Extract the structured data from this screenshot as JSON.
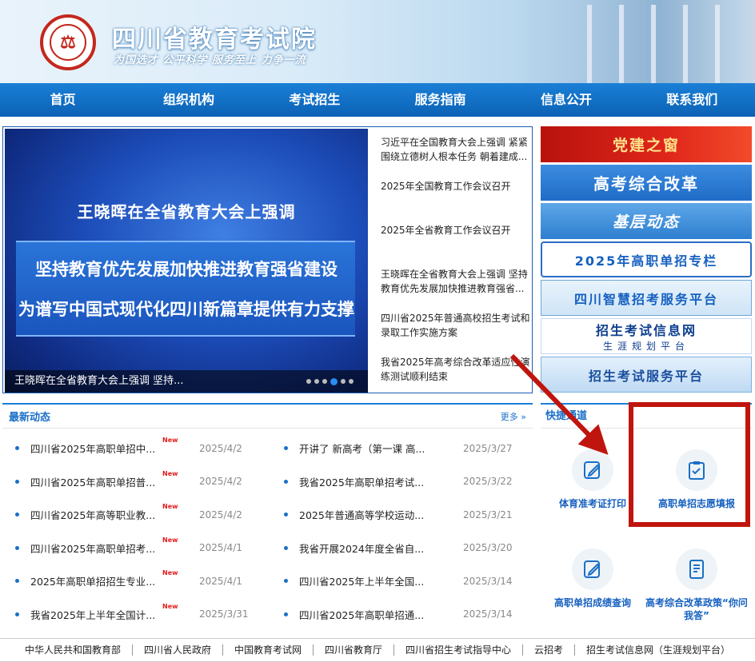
{
  "header": {
    "logo_text": "四川省教育考试院",
    "title": "四川省教育考试院",
    "motto": "为国选才  公平科学  服务至上  力争一流"
  },
  "nav": [
    {
      "label": "首页"
    },
    {
      "label": "组织机构"
    },
    {
      "label": "考试招生"
    },
    {
      "label": "服务指南"
    },
    {
      "label": "信息公开"
    },
    {
      "label": "联系我们"
    }
  ],
  "banner": {
    "line1": "王晓晖在全省教育大会上强调",
    "line2": "坚持教育优先发展加快推进教育强省建设",
    "line3": "为谱写中国式现代化四川新篇章提供有力支撑",
    "caption": "王晓晖在全省教育大会上强调 坚持...",
    "active_dot": 3
  },
  "top_news": [
    "习近平在全国教育大会上强调 紧紧围绕立德树人根本任务 朝着建成...",
    "2025年全国教育工作会议召开",
    "2025年全省教育工作会议召开",
    "王晓晖在全省教育大会上强调 坚持教育优先发展加快推进教育强省...",
    "四川省2025年普通高校招生考试和录取工作实施方案",
    "我省2025年高考综合改革适应性演练测试顺利结束"
  ],
  "side_buttons": {
    "party": "党建之窗",
    "reform": "高考综合改革",
    "grassroots": "基层动态",
    "gaozhi": "2025年高职单招专栏",
    "smart": "四川智慧招考服务平台",
    "netinfo": "招生考试信息网",
    "netinfo_sub": "生涯规划平台",
    "service": "招生考试服务平台"
  },
  "latest": {
    "title": "最新动态",
    "more": "更多 »",
    "new_label": "New",
    "left": [
      {
        "text": "四川省2025年高职单招中...",
        "date": "2025/4/2",
        "new": true
      },
      {
        "text": "四川省2025年高职单招普...",
        "date": "2025/4/2",
        "new": true
      },
      {
        "text": "四川省2025年高等职业教...",
        "date": "2025/4/2",
        "new": true
      },
      {
        "text": "四川省2025年高职单招考...",
        "date": "2025/4/1",
        "new": true
      },
      {
        "text": "2025年高职单招招生专业...",
        "date": "2025/4/1",
        "new": true
      },
      {
        "text": "我省2025年上半年全国计...",
        "date": "2025/3/31",
        "new": true
      }
    ],
    "right": [
      {
        "text": "开讲了 新高考（第一课 高...",
        "date": "2025/3/27"
      },
      {
        "text": "我省2025年高职单招考试...",
        "date": "2025/3/22"
      },
      {
        "text": "2025年普通高等学校运动...",
        "date": "2025/3/21"
      },
      {
        "text": "我省开展2024年度全省自...",
        "date": "2025/3/20"
      },
      {
        "text": "四川省2025年上半年全国...",
        "date": "2025/3/14"
      },
      {
        "text": "四川省2025年高职单招通...",
        "date": "2025/3/14"
      }
    ]
  },
  "quick": {
    "title": "快捷通道",
    "items": [
      {
        "label": "体育准考证打印"
      },
      {
        "label": "高职单招志愿填报"
      },
      {
        "label": "高职单招成绩查询"
      },
      {
        "label": "高考综合改革政策“你问我答”"
      }
    ]
  },
  "footer_links": [
    "中华人民共和国教育部",
    "四川省人民政府",
    "中国教育考试网",
    "四川省教育厅",
    "四川省招生考试指导中心",
    "云招考",
    "招生考试信息网（生涯规划平台）"
  ],
  "colors": {
    "nav_blue": "#0b62b5",
    "accent_blue": "#1a6fc7",
    "annotation_red": "#c0150e",
    "new_red": "#e31b1b"
  }
}
